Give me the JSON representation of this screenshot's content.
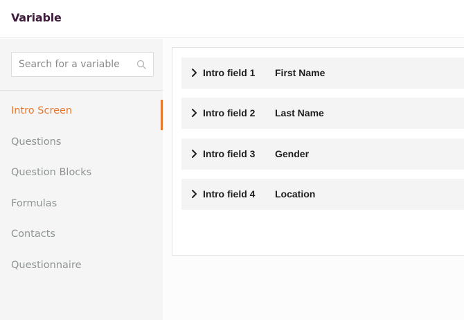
{
  "header": {
    "title": "Variable"
  },
  "search": {
    "placeholder": "Search for a variable",
    "icon": "search-icon"
  },
  "sidebar": {
    "active_color": "#e8772e",
    "items": [
      {
        "label": "Intro Screen",
        "active": true
      },
      {
        "label": "Questions",
        "active": false
      },
      {
        "label": "Question Blocks",
        "active": false
      },
      {
        "label": "Formulas",
        "active": false
      },
      {
        "label": "Contacts",
        "active": false
      },
      {
        "label": "Questionnaire",
        "active": false
      }
    ]
  },
  "main": {
    "rows": [
      {
        "field": "Intro field 1",
        "value": "First Name",
        "icon": "chevron-right-icon"
      },
      {
        "field": "Intro field 2",
        "value": "Last Name",
        "icon": "chevron-right-icon"
      },
      {
        "field": "Intro field 3",
        "value": "Gender",
        "icon": "chevron-right-icon"
      },
      {
        "field": "Intro field 4",
        "value": "Location",
        "icon": "chevron-right-icon"
      }
    ]
  }
}
